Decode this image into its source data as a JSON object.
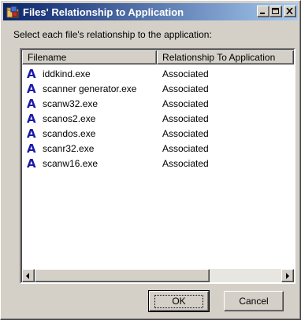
{
  "window": {
    "title": "Files' Relationship to Application",
    "icon": "folder-app-icon"
  },
  "title_buttons": {
    "minimize": "minimize-icon",
    "maximize": "maximize-icon",
    "close": "close-icon"
  },
  "prompt": "Select each file's relationship to the application:",
  "list": {
    "columns": [
      "Filename",
      "Relationship To Application"
    ],
    "rows": [
      {
        "filename": "iddkind.exe",
        "relationship": "Associated"
      },
      {
        "filename": "scanner generator.exe",
        "relationship": "Associated"
      },
      {
        "filename": "scanw32.exe",
        "relationship": "Associated"
      },
      {
        "filename": "scanos2.exe",
        "relationship": "Associated"
      },
      {
        "filename": "scandos.exe",
        "relationship": "Associated"
      },
      {
        "filename": "scanr32.exe",
        "relationship": "Associated"
      },
      {
        "filename": "scanw16.exe",
        "relationship": "Associated"
      }
    ],
    "row_icon": "A"
  },
  "buttons": {
    "ok": "OK",
    "cancel": "Cancel"
  },
  "colors": {
    "titlebar_start": "#0a246a",
    "titlebar_end": "#a6caf0",
    "face": "#d4d0c8",
    "file_icon": "#1a1aa8"
  }
}
